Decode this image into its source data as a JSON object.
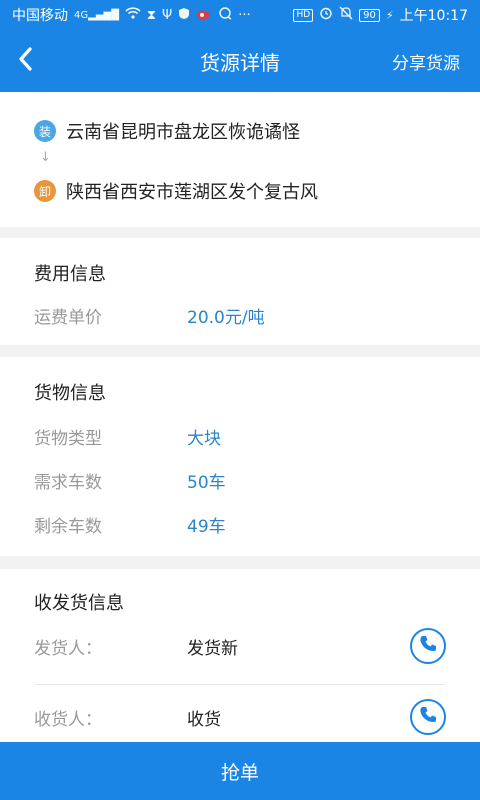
{
  "status_bar": {
    "carrier": "中国移动",
    "network": "4G",
    "hd": "HD",
    "battery": "90",
    "time": "上午10:17",
    "more": "···"
  },
  "navbar": {
    "title": "货源详情",
    "share_label": "分享货源"
  },
  "route": {
    "load_badge": "装",
    "load_address": "云南省昆明市盘龙区恢诡谲怪",
    "arrow": "↓",
    "unload_badge": "卸",
    "unload_address": "陕西省西安市莲湖区发个复古风"
  },
  "fee_info": {
    "title": "费用信息",
    "rows": [
      {
        "label": "运费单价",
        "value": "20.0元/吨"
      }
    ]
  },
  "cargo_info": {
    "title": "货物信息",
    "rows": [
      {
        "label": "货物类型",
        "value": "大块"
      },
      {
        "label": "需求车数",
        "value": "50车"
      },
      {
        "label": "剩余车数",
        "value": "49车"
      }
    ]
  },
  "contact_info": {
    "title": "收发货信息",
    "rows": [
      {
        "label": "发货人：",
        "value": "发货新"
      },
      {
        "label": "收货人：",
        "value": "收货"
      }
    ]
  },
  "footer": {
    "grab_label": "抢单"
  },
  "colors": {
    "primary": "#1b85e5",
    "value_blue": "#2a86c9",
    "load_badge": "#4aa6e8",
    "unload_badge": "#e8963c"
  }
}
